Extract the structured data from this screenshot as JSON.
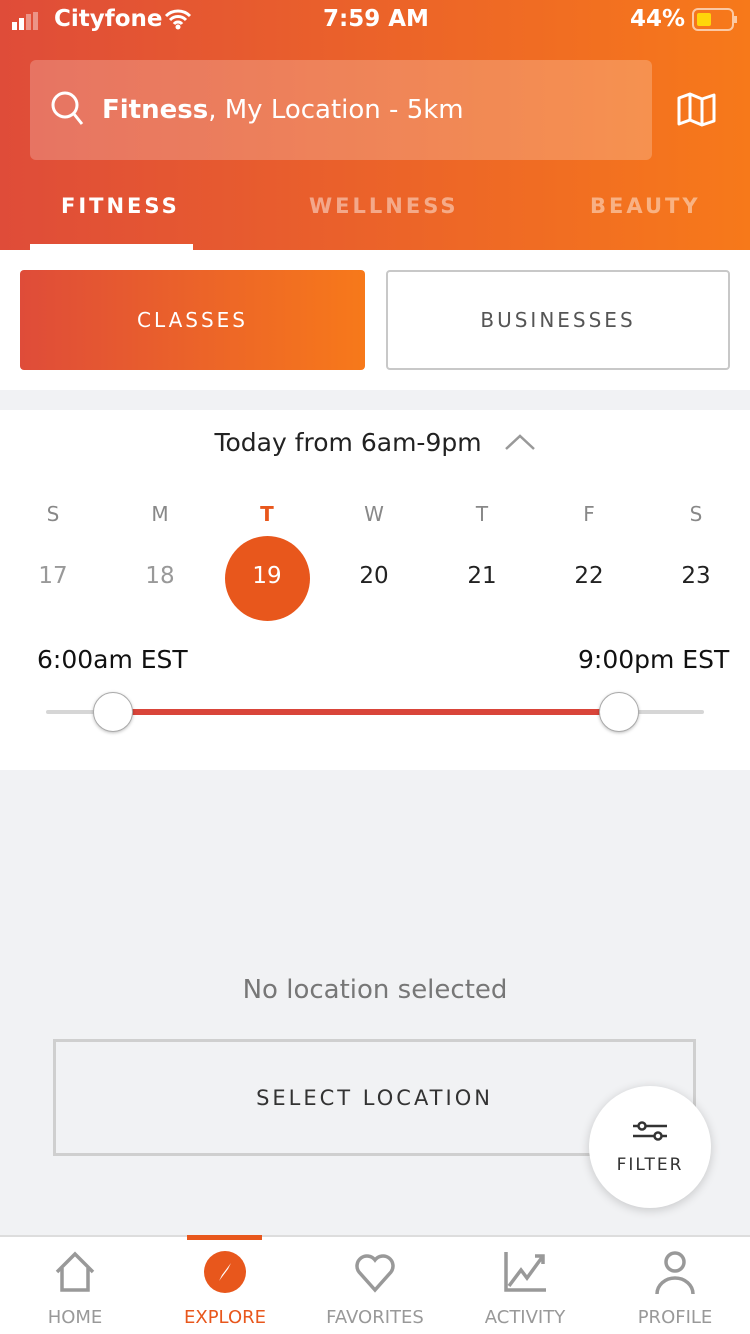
{
  "status": {
    "carrier": "Cityfone",
    "time": "7:59 AM",
    "battery": "44%"
  },
  "search": {
    "category": "Fitness",
    "rest": ", My Location - 5km"
  },
  "tabs": [
    "FITNESS",
    "WELLNESS",
    "BEAUTY"
  ],
  "segments": {
    "classes": "CLASSES",
    "businesses": "BUSINESSES"
  },
  "schedule": {
    "title": "Today from 6am-9pm",
    "days": [
      {
        "l": "S",
        "n": "17"
      },
      {
        "l": "M",
        "n": "18"
      },
      {
        "l": "T",
        "n": "19"
      },
      {
        "l": "W",
        "n": "20"
      },
      {
        "l": "T",
        "n": "21"
      },
      {
        "l": "F",
        "n": "22"
      },
      {
        "l": "S",
        "n": "23"
      }
    ],
    "start": "6:00am EST",
    "end": "9:00pm EST"
  },
  "empty": {
    "message": "No location selected",
    "button": "SELECT LOCATION"
  },
  "filter": "FILTER",
  "nav": [
    "HOME",
    "EXPLORE",
    "FAVORITES",
    "ACTIVITY",
    "PROFILE"
  ],
  "colors": {
    "accent": "#e8571c",
    "gradient_start": "#df4c39",
    "gradient_end": "#f7791a"
  }
}
